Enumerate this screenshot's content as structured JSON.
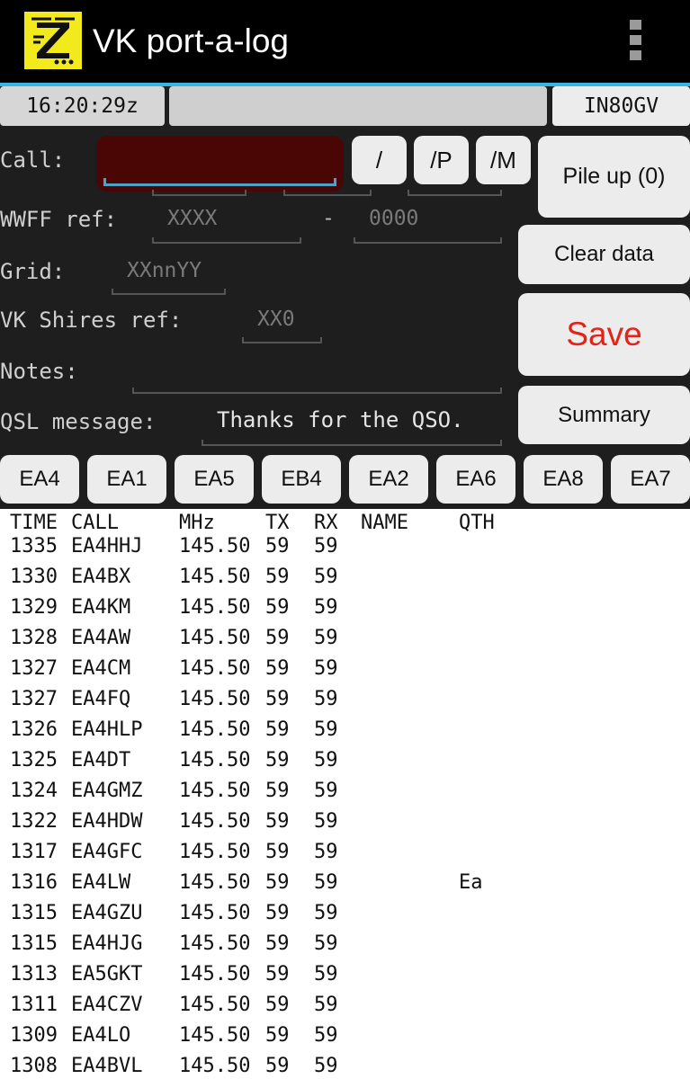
{
  "app": {
    "title": "VK port-a-log"
  },
  "status_bar": {
    "clock": "16:20:29z",
    "grid_locator": "IN80GV"
  },
  "form": {
    "call_label": "Call:",
    "slash_label": "/",
    "portable_label": "/P",
    "mobile_label": "/M",
    "pileup_label": "Pile up (0)",
    "wwff_label": "WWFF ref:",
    "wwff_prefix_placeholder": "XXXX",
    "wwff_dash": "-",
    "wwff_number_placeholder": "0000",
    "grid_label": "Grid:",
    "grid_placeholder": "XXnnYY",
    "shires_label": "VK Shires ref:",
    "shires_placeholder": "XX0",
    "notes_label": "Notes:",
    "qsl_label": "QSL message:",
    "qsl_value": "Thanks for the QSO.",
    "clear_label": "Clear data",
    "save_label": "Save",
    "summary_label": "Summary",
    "save_color": "#e2231a"
  },
  "prefixes": [
    "EA4",
    "EA1",
    "EA5",
    "EB4",
    "EA2",
    "EA6",
    "EA8",
    "EA7"
  ],
  "log": {
    "headers": {
      "time": "TIME",
      "call": "CALL",
      "mhz": "MHz",
      "tx": "TX",
      "rx": "RX",
      "name": "NAME",
      "qth": "QTH"
    },
    "rows": [
      {
        "time": "1335",
        "call": "EA4HHJ",
        "mhz": "145.50",
        "tx": "59",
        "rx": "59",
        "name": "",
        "qth": ""
      },
      {
        "time": "1330",
        "call": "EA4BX",
        "mhz": "145.50",
        "tx": "59",
        "rx": "59",
        "name": "",
        "qth": ""
      },
      {
        "time": "1329",
        "call": "EA4KM",
        "mhz": "145.50",
        "tx": "59",
        "rx": "59",
        "name": "",
        "qth": ""
      },
      {
        "time": "1328",
        "call": "EA4AW",
        "mhz": "145.50",
        "tx": "59",
        "rx": "59",
        "name": "",
        "qth": ""
      },
      {
        "time": "1327",
        "call": "EA4CM",
        "mhz": "145.50",
        "tx": "59",
        "rx": "59",
        "name": "",
        "qth": ""
      },
      {
        "time": "1327",
        "call": "EA4FQ",
        "mhz": "145.50",
        "tx": "59",
        "rx": "59",
        "name": "",
        "qth": ""
      },
      {
        "time": "1326",
        "call": "EA4HLP",
        "mhz": "145.50",
        "tx": "59",
        "rx": "59",
        "name": "",
        "qth": ""
      },
      {
        "time": "1325",
        "call": "EA4DT",
        "mhz": "145.50",
        "tx": "59",
        "rx": "59",
        "name": "",
        "qth": ""
      },
      {
        "time": "1324",
        "call": "EA4GMZ",
        "mhz": "145.50",
        "tx": "59",
        "rx": "59",
        "name": "",
        "qth": ""
      },
      {
        "time": "1322",
        "call": "EA4HDW",
        "mhz": "145.50",
        "tx": "59",
        "rx": "59",
        "name": "",
        "qth": ""
      },
      {
        "time": "1317",
        "call": "EA4GFC",
        "mhz": "145.50",
        "tx": "59",
        "rx": "59",
        "name": "",
        "qth": ""
      },
      {
        "time": "1316",
        "call": "EA4LW",
        "mhz": "145.50",
        "tx": "59",
        "rx": "59",
        "name": "",
        "qth": "Ea"
      },
      {
        "time": "1315",
        "call": "EA4GZU",
        "mhz": "145.50",
        "tx": "59",
        "rx": "59",
        "name": "",
        "qth": ""
      },
      {
        "time": "1315",
        "call": "EA4HJG",
        "mhz": "145.50",
        "tx": "59",
        "rx": "59",
        "name": "",
        "qth": ""
      },
      {
        "time": "1313",
        "call": "EA5GKT",
        "mhz": "145.50",
        "tx": "59",
        "rx": "59",
        "name": "",
        "qth": ""
      },
      {
        "time": "1311",
        "call": "EA4CZV",
        "mhz": "145.50",
        "tx": "59",
        "rx": "59",
        "name": "",
        "qth": ""
      },
      {
        "time": "1309",
        "call": "EA4LO",
        "mhz": "145.50",
        "tx": "59",
        "rx": "59",
        "name": "",
        "qth": ""
      },
      {
        "time": "1308",
        "call": "EA4BVL",
        "mhz": "145.50",
        "tx": "59",
        "rx": "59",
        "name": "",
        "qth": ""
      }
    ]
  },
  "icons": {
    "logo": "antenna-z-logo-icon",
    "overflow": "overflow-menu-icon"
  },
  "colors": {
    "accent": "#33b5e5",
    "call_field": "#4a0505",
    "logo_bg": "#f2ea1c"
  }
}
